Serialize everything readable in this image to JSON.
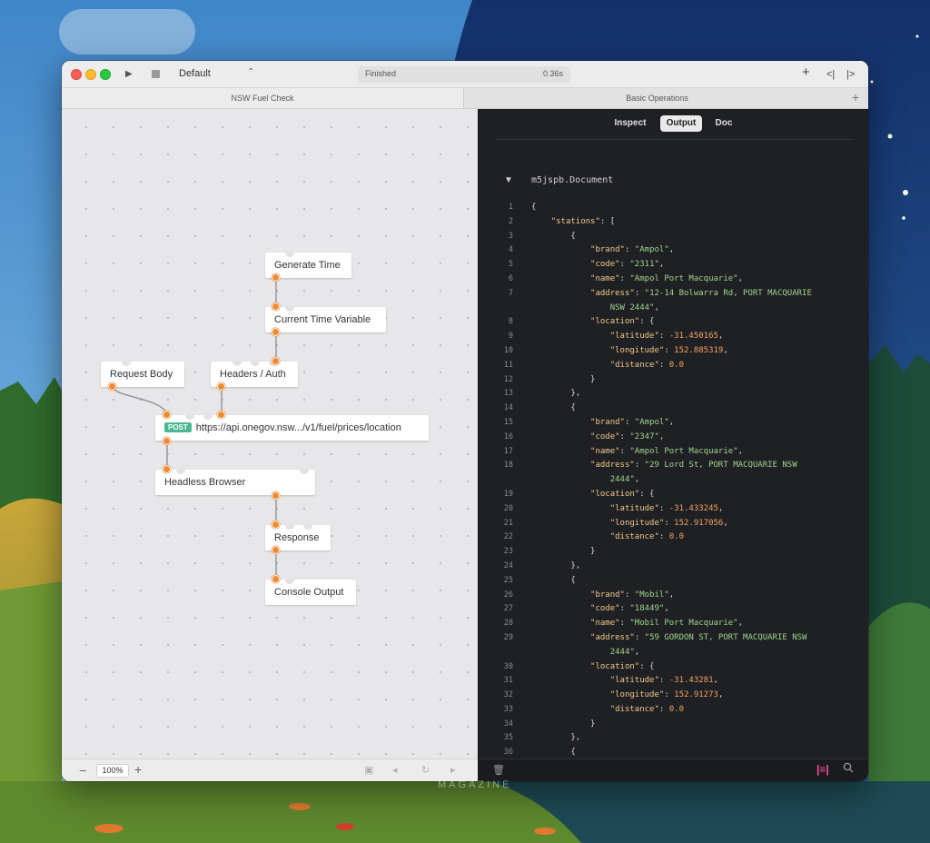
{
  "toolbar": {
    "scheme": "Default",
    "status": "Finished",
    "duration": "0.36s"
  },
  "tabs": [
    {
      "label": "NSW Fuel Check"
    },
    {
      "label": "Basic Operations"
    }
  ],
  "nodes": {
    "generate_time": "Generate Time",
    "current_time_variable": "Current Time Variable",
    "request_body": "Request Body",
    "headers_auth": "Headers / Auth",
    "post_method": "POST",
    "post_url": "https://api.onegov.nsw.../v1/fuel/prices/location",
    "headless_browser": "Headless Browser",
    "response": "Response",
    "console_output": "Console Output"
  },
  "canvas_footer": {
    "zoom": "100%"
  },
  "inspector": {
    "tabs": [
      "Inspect",
      "Output",
      "Doc"
    ],
    "active_tab": "Output",
    "document_title": "m5jspb.Document",
    "lines": [
      {
        "n": "1",
        "t": "{"
      },
      {
        "n": "2",
        "t": "    \"stations\": ["
      },
      {
        "n": "3",
        "t": "        {"
      },
      {
        "n": "4",
        "t": "            \"brand\": \"Ampol\","
      },
      {
        "n": "5",
        "t": "            \"code\": \"2311\","
      },
      {
        "n": "6",
        "t": "            \"name\": \"Ampol Port Macquarie\","
      },
      {
        "n": "7",
        "t": "            \"address\": \"12-14 Bolwarra Rd, PORT MACQUARIE"
      },
      {
        "n": "",
        "t": "                NSW 2444\","
      },
      {
        "n": "8",
        "t": "            \"location\": {"
      },
      {
        "n": "9",
        "t": "                \"latitude\": -31.450165,"
      },
      {
        "n": "10",
        "t": "                \"longitude\": 152.885319,"
      },
      {
        "n": "11",
        "t": "                \"distance\": 0.0"
      },
      {
        "n": "12",
        "t": "            }"
      },
      {
        "n": "13",
        "t": "        },"
      },
      {
        "n": "14",
        "t": "        {"
      },
      {
        "n": "15",
        "t": "            \"brand\": \"Ampol\","
      },
      {
        "n": "16",
        "t": "            \"code\": \"2347\","
      },
      {
        "n": "17",
        "t": "            \"name\": \"Ampol Port Macquarie\","
      },
      {
        "n": "18",
        "t": "            \"address\": \"29 Lord St, PORT MACQUARIE NSW"
      },
      {
        "n": "",
        "t": "                2444\","
      },
      {
        "n": "19",
        "t": "            \"location\": {"
      },
      {
        "n": "20",
        "t": "                \"latitude\": -31.433245,"
      },
      {
        "n": "21",
        "t": "                \"longitude\": 152.917056,"
      },
      {
        "n": "22",
        "t": "                \"distance\": 0.0"
      },
      {
        "n": "23",
        "t": "            }"
      },
      {
        "n": "24",
        "t": "        },"
      },
      {
        "n": "25",
        "t": "        {"
      },
      {
        "n": "26",
        "t": "            \"brand\": \"Mobil\","
      },
      {
        "n": "27",
        "t": "            \"code\": \"18449\","
      },
      {
        "n": "28",
        "t": "            \"name\": \"Mobil Port Macquarie\","
      },
      {
        "n": "29",
        "t": "            \"address\": \"59 GORDON ST, PORT MACQUARIE NSW"
      },
      {
        "n": "",
        "t": "                2444\","
      },
      {
        "n": "30",
        "t": "            \"location\": {"
      },
      {
        "n": "31",
        "t": "                \"latitude\": -31.43281,"
      },
      {
        "n": "32",
        "t": "                \"longitude\": 152.91273,"
      },
      {
        "n": "33",
        "t": "                \"distance\": 0.0"
      },
      {
        "n": "34",
        "t": "            }"
      },
      {
        "n": "35",
        "t": "        },"
      },
      {
        "n": "36",
        "t": "        {"
      }
    ]
  },
  "watermark": "MAGAZINE",
  "colors": {
    "port": "#f08a2e",
    "post_badge": "#4cb892",
    "json_key": "#f0c88a",
    "json_string": "#9fd48f",
    "json_number": "#f2a463",
    "wrap_icon": "#ff4fa3"
  }
}
